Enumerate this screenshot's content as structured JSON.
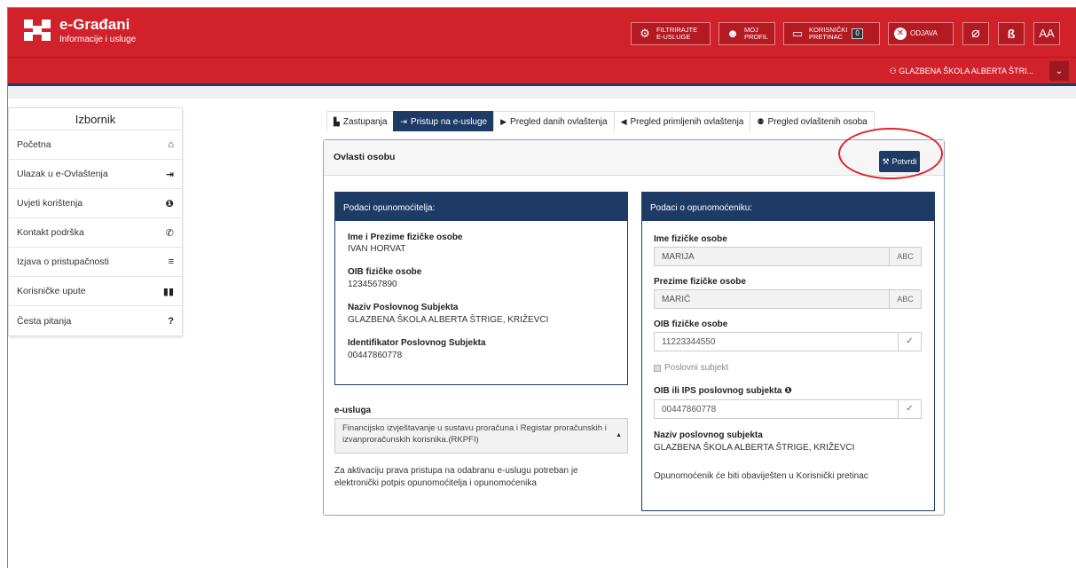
{
  "header": {
    "brand_title": "e-Građani",
    "brand_sub": "Informacije i usluge",
    "btn_filter": [
      "FILTRIRAJTE",
      "E-USLUGE"
    ],
    "btn_profile": [
      "MOJ",
      "PROFIL"
    ],
    "btn_inbox": [
      "KORISNIČKI",
      "PRETINAC"
    ],
    "inbox_count": "0",
    "btn_logout": "ODJAVA",
    "btn_font": "AA",
    "user_name": "GLAZBENA ŠKOLA ALBERTA ŠTRI..."
  },
  "sidebar": {
    "title": "Izbornik",
    "items": [
      {
        "label": "Početna",
        "icon": "home-icon"
      },
      {
        "label": "Ulazak u e-Ovlaštenja",
        "icon": "sign-in-icon"
      },
      {
        "label": "Uvjeti korištenja",
        "icon": "info-icon"
      },
      {
        "label": "Kontakt podrška",
        "icon": "phone-icon"
      },
      {
        "label": "Izjava o pristupačnosti",
        "icon": "align-icon"
      },
      {
        "label": "Korisničke upute",
        "icon": "book-icon"
      },
      {
        "label": "Česta pitanja",
        "icon": "question-icon"
      }
    ]
  },
  "tabs": [
    "Zastupanja",
    "Pristup na e-usluge",
    "Pregled danih ovlaštenja",
    "Pregled primljenih ovlaštenja",
    "Pregled ovlaštenih osoba"
  ],
  "panel": {
    "title": "Ovlasti osobu",
    "confirm_label": "Potvrdi"
  },
  "grantor": {
    "heading": "Podaci opunomoćitelja:",
    "name_label": "Ime i Prezime fizičke osobe",
    "name_value": "IVAN HORVAT",
    "oib_label": "OIB fizičke osobe",
    "oib_value": "1234567890",
    "company_label": "Naziv Poslovnog Subjekta",
    "company_value": "GLAZBENA ŠKOLA ALBERTA ŠTRIGE, KRIŽEVCI",
    "company_id_label": "Identifikator Poslovnog Subjekta",
    "company_id_value": "00447860778"
  },
  "service": {
    "label": "e-usluga",
    "selected": "Financijsko izvještavanje u sustavu proračuna i Registar proračunskih i izvanproračunskih korisnika.(RKPFI)",
    "note": "Za aktivaciju prava pristupa na odabranu e-uslugu potreban je elektronički potpis opunomoćitelja i opunomoćenika"
  },
  "grantee": {
    "heading": "Podaci o opunomoćeniku:",
    "first_name_label": "Ime fizičke osobe",
    "first_name_value": "MARIJA",
    "last_name_label": "Prezime fizičke osobe",
    "last_name_value": "MARIĆ",
    "addon": "ABC",
    "oib_label": "OIB fizičke osobe",
    "oib_value": "11223344550",
    "business_checkbox": "Poslovni subjekt",
    "company_oib_label": "OIB ili IPS poslovnog subjekta",
    "company_oib_value": "00447860778",
    "company_name_label": "Naziv poslovnog subjekta",
    "company_name_value": "GLAZBENA ŠKOLA ALBERTA ŠTRIGE, KRIŽEVCI",
    "notice": "Opunomoćenik će biti obaviješten u Korisnički pretinac"
  },
  "colors": {
    "brand_red": "#d1212a",
    "navy": "#1e3b66",
    "highlight": "#e2222b"
  }
}
